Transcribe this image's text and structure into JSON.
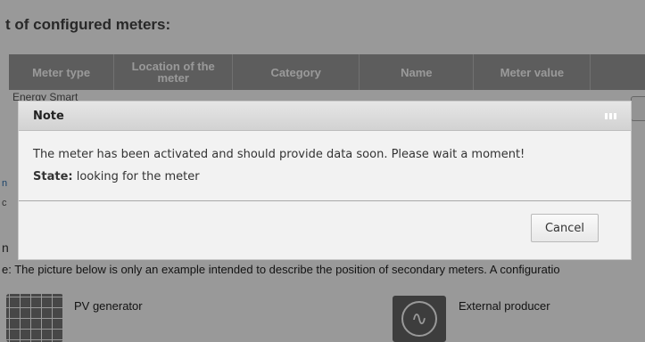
{
  "background": {
    "section_title": "t of configured meters:",
    "table": {
      "columns": [
        "Meter type",
        "Location of the meter",
        "Category",
        "Name",
        "Meter value",
        ""
      ]
    },
    "peek_row_text": "Energy Smart",
    "side_text_blue": "n",
    "side_text_c": "c",
    "side_text_n": "n",
    "hint": "e: The picture below is only an example intended to describe the position of secondary meters. A configuratio",
    "items": [
      {
        "label": "PV generator",
        "icon": "solar-panel-icon"
      },
      {
        "label": "External producer",
        "icon": "ac-generator-icon"
      }
    ]
  },
  "dialog": {
    "title": "Note",
    "message": "The meter has been activated and should provide data soon. Please wait a moment!",
    "state_label": "State:",
    "state_value": "looking for the meter",
    "cancel_label": "Cancel"
  },
  "colors": {
    "overlay": "rgba(0,0,0,0.4)",
    "table_header": "#9c9c9c",
    "dialog_bg": "#f2f2f2"
  }
}
